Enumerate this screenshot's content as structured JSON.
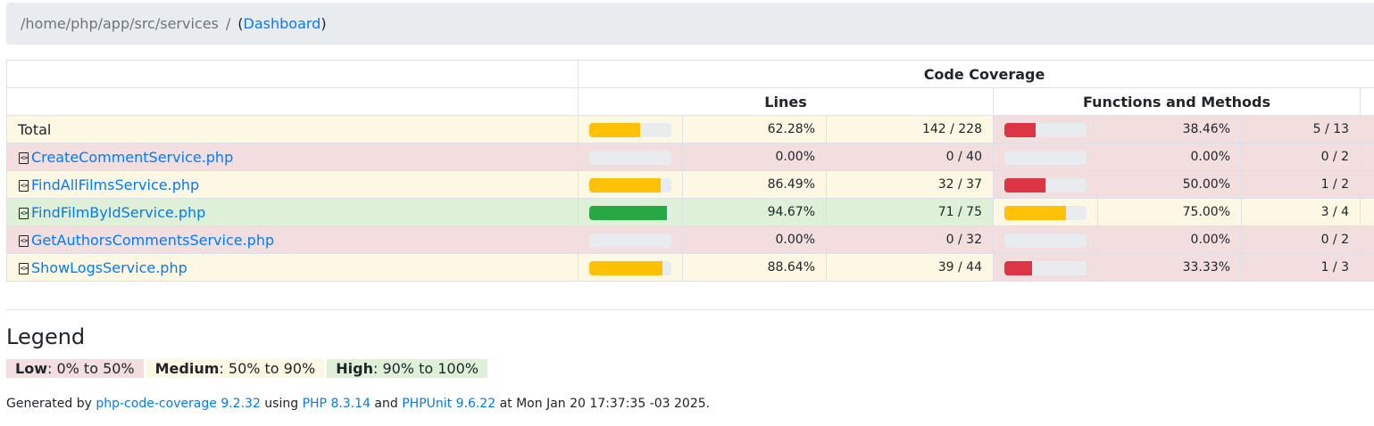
{
  "breadcrumb": {
    "path": "/home/php/app/src/services",
    "separator": "/",
    "dashboard_open": "(",
    "dashboard_label": "Dashboard",
    "dashboard_close": ")"
  },
  "table": {
    "header_main": "Code Coverage",
    "header_lines": "Lines",
    "header_functions": "Functions and Methods",
    "rows": [
      {
        "name": "Total",
        "level": "medium",
        "is_total": true,
        "lines_pct": "62.28%",
        "lines_ratio": "142 / 228",
        "lines_fraction": 0.6228,
        "lines_level": "medium",
        "funcs_pct": "38.46%",
        "funcs_ratio": "5 / 13",
        "funcs_fraction": 0.3846,
        "funcs_level": "low"
      },
      {
        "name": "CreateCommentService.php",
        "level": "low",
        "lines_pct": "0.00%",
        "lines_ratio": "0 / 40",
        "lines_fraction": 0,
        "lines_level": "low",
        "funcs_pct": "0.00%",
        "funcs_ratio": "0 / 2",
        "funcs_fraction": 0,
        "funcs_level": "low"
      },
      {
        "name": "FindAllFilmsService.php",
        "level": "medium",
        "lines_pct": "86.49%",
        "lines_ratio": "32 / 37",
        "lines_fraction": 0.8649,
        "lines_level": "medium",
        "funcs_pct": "50.00%",
        "funcs_ratio": "1 / 2",
        "funcs_fraction": 0.5,
        "funcs_level": "low"
      },
      {
        "name": "FindFilmByIdService.php",
        "level": "high",
        "lines_pct": "94.67%",
        "lines_ratio": "71 / 75",
        "lines_fraction": 0.9467,
        "lines_level": "high",
        "funcs_pct": "75.00%",
        "funcs_ratio": "3 / 4",
        "funcs_fraction": 0.75,
        "funcs_level": "medium"
      },
      {
        "name": "GetAuthorsCommentsService.php",
        "level": "low",
        "lines_pct": "0.00%",
        "lines_ratio": "0 / 32",
        "lines_fraction": 0,
        "lines_level": "low",
        "funcs_pct": "0.00%",
        "funcs_ratio": "0 / 2",
        "funcs_fraction": 0,
        "funcs_level": "low"
      },
      {
        "name": "ShowLogsService.php",
        "level": "medium",
        "lines_pct": "88.64%",
        "lines_ratio": "39 / 44",
        "lines_fraction": 0.8864,
        "lines_level": "medium",
        "funcs_pct": "33.33%",
        "funcs_ratio": "1 / 3",
        "funcs_fraction": 0.3333,
        "funcs_level": "low"
      }
    ]
  },
  "legend": {
    "title": "Legend",
    "low_label": "Low",
    "low_range": ": 0% to 50%",
    "medium_label": "Medium",
    "medium_range": ": 50% to 90%",
    "high_label": "High",
    "high_range": ": 90% to 100%"
  },
  "footer": {
    "generated_by": "Generated by ",
    "tool_link": "php-code-coverage 9.2.32",
    "using": " using ",
    "php_link": "PHP 8.3.14",
    "and": " and ",
    "phpunit_link": "PHPUnit 9.6.22",
    "at": " at Mon Jan 20 17:37:35 -03 2025."
  },
  "colors": {
    "low": "#f2dede",
    "medium": "#fcf8e3",
    "high": "#dff0d8",
    "bar_low": "#dc3545",
    "bar_medium": "#ffc107",
    "bar_high": "#28a745",
    "link": "#007bff"
  }
}
